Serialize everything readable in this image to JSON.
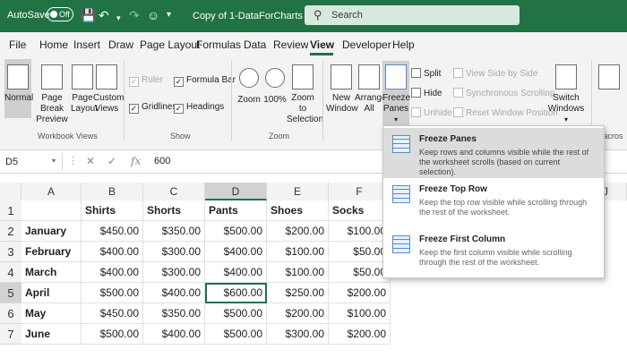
{
  "titlebar": {
    "autosave_label": "AutoSave",
    "autosave_state": "Off",
    "doc_title": "Copy of 1-DataForCharts",
    "search_placeholder": "Search",
    "brand_color": "#217346"
  },
  "menu": {
    "tabs": [
      "File",
      "Home",
      "Insert",
      "Draw",
      "Page Layout",
      "Formulas",
      "Data",
      "Review",
      "View",
      "Developer",
      "Help"
    ],
    "active": "View"
  },
  "ribbon": {
    "workbook_views": {
      "label": "Workbook Views",
      "normal": "Normal",
      "page_break_1": "Page Break",
      "page_break_2": "Preview",
      "page_layout_1": "Page",
      "page_layout_2": "Layout",
      "custom_views_1": "Custom",
      "custom_views_2": "Views"
    },
    "show": {
      "label": "Show",
      "ruler": "Ruler",
      "formula_bar": "Formula Bar",
      "gridlines": "Gridlines",
      "headings": "Headings"
    },
    "zoom": {
      "label": "Zoom",
      "zoom": "Zoom",
      "hundred": "100%",
      "zoom_sel_1": "Zoom to",
      "zoom_sel_2": "Selection"
    },
    "window": {
      "new_window_1": "New",
      "new_window_2": "Window",
      "arrange_1": "Arrange",
      "arrange_2": "All",
      "freeze_1": "Freeze",
      "freeze_2": "Panes",
      "split": "Split",
      "hide": "Hide",
      "unhide": "Unhide",
      "side_by_side": "View Side by Side",
      "sync_scroll": "Synchronous Scrolling",
      "reset_pos": "Reset Window Position",
      "switch_1": "Switch",
      "switch_2": "Windows"
    },
    "macros": {
      "label": "Macros"
    }
  },
  "formula_bar": {
    "name_box": "D5",
    "value": "600"
  },
  "grid": {
    "columns": [
      "A",
      "B",
      "C",
      "D",
      "E",
      "F",
      "J"
    ],
    "rows": [
      [
        "",
        "Shirts",
        "Shorts",
        "Pants",
        "Shoes",
        "Socks"
      ],
      [
        "January",
        "$450.00",
        "$350.00",
        "$500.00",
        "$200.00",
        "$100.00"
      ],
      [
        "February",
        "$400.00",
        "$300.00",
        "$400.00",
        "$100.00",
        "$50.00"
      ],
      [
        "March",
        "$400.00",
        "$300.00",
        "$400.00",
        "$100.00",
        "$50.00"
      ],
      [
        "April",
        "$500.00",
        "$400.00",
        "$600.00",
        "$250.00",
        "$200.00"
      ],
      [
        "May",
        "$450.00",
        "$350.00",
        "$500.00",
        "$200.00",
        "$100.00"
      ],
      [
        "June",
        "$500.00",
        "$400.00",
        "$500.00",
        "$300.00",
        "$200.00"
      ]
    ],
    "row_numbers": [
      "1",
      "2",
      "3",
      "4",
      "5",
      "6",
      "7"
    ],
    "active_cell": "D5"
  },
  "freeze_menu": {
    "items": [
      {
        "title": "Freeze Panes",
        "desc": "Keep rows and columns visible while the rest of the worksheet scrolls (based on current selection)."
      },
      {
        "title": "Freeze Top Row",
        "desc": "Keep the top row visible while scrolling through the rest of the worksheet."
      },
      {
        "title": "Freeze First Column",
        "desc": "Keep the first column visible while scrolling through the rest of the worksheet."
      }
    ]
  }
}
